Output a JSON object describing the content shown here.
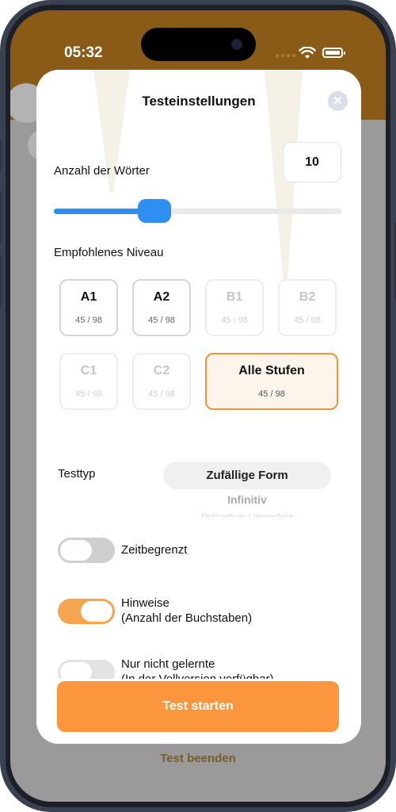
{
  "status_bar": {
    "time": "05:32"
  },
  "background": {
    "end_test_label": "Test beenden"
  },
  "modal": {
    "title": "Testeinstellungen",
    "close_icon": "close-icon",
    "word_count": {
      "label": "Anzahl der Wörter",
      "value": "10",
      "slider_fraction": 0.35
    },
    "level_section": {
      "label": "Empfohlenes Niveau",
      "levels": [
        {
          "name": "A1",
          "count": "45 / 98",
          "state": "selected"
        },
        {
          "name": "A2",
          "count": "45 / 98",
          "state": "selected"
        },
        {
          "name": "B1",
          "count": "45 / 98",
          "state": "disabled"
        },
        {
          "name": "B2",
          "count": "45 / 98",
          "state": "disabled"
        },
        {
          "name": "C1",
          "count": "45 / 98",
          "state": "disabled"
        },
        {
          "name": "C2",
          "count": "45 / 98",
          "state": "disabled"
        },
        {
          "name": "Alle Stufen",
          "count": "45 / 98",
          "state": "active"
        }
      ]
    },
    "test_type": {
      "label": "Testtyp",
      "selected": "Zufällige Form",
      "next_option": "Infinitiv",
      "partial_option": "Präteritum / Imperfekt"
    },
    "toggles": [
      {
        "label_line1": "Zeitbegrenzt",
        "label_line2": "",
        "on": false
      },
      {
        "label_line1": "Hinweise",
        "label_line2": "(Anzahl der Buchstaben)",
        "on": true
      },
      {
        "label_line1": "Nur nicht gelernte",
        "label_line2": "(In der Vollversion verfügbar)",
        "on": false
      }
    ],
    "start_button": "Test starten"
  },
  "colors": {
    "header": "#8a5a17",
    "accent_blue": "#2f8ff0",
    "accent_orange": "#fb963f",
    "toggle_on": "#f6a44f"
  }
}
